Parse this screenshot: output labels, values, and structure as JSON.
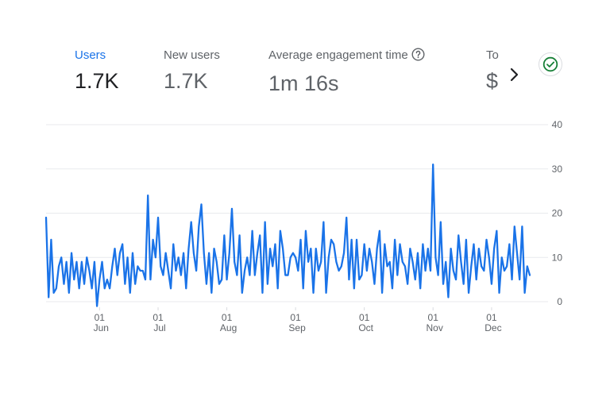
{
  "metrics": [
    {
      "label": "Users",
      "value": "1.7K"
    },
    {
      "label": "New users",
      "value": "1.7K"
    },
    {
      "label": "Average engagement time",
      "value": "1m 16s"
    },
    {
      "label": "To",
      "value": "$"
    }
  ],
  "icons": {
    "help": "help-circle-icon",
    "next": "chevron-right-icon",
    "status": "check-circle-icon"
  },
  "colors": {
    "accent": "#1a73e8",
    "line": "#1a73e8",
    "success": "#188038"
  },
  "chart_data": {
    "type": "line",
    "title": "",
    "ylim": [
      0,
      40
    ],
    "y_ticks": [
      "0",
      "10",
      "20",
      "30",
      "40"
    ],
    "x_ticks": [
      {
        "day": "01",
        "month": "Jun",
        "index": 21
      },
      {
        "day": "01",
        "month": "Jul",
        "index": 44
      },
      {
        "day": "01",
        "month": "Aug",
        "index": 71
      },
      {
        "day": "01",
        "month": "Sep",
        "index": 98
      },
      {
        "day": "01",
        "month": "Oct",
        "index": 125
      },
      {
        "day": "01",
        "month": "Nov",
        "index": 152
      },
      {
        "day": "01",
        "month": "Dec",
        "index": 175
      }
    ],
    "series": [
      {
        "values": [
          19,
          1,
          14,
          2,
          3,
          8,
          10,
          4,
          9,
          2,
          11,
          5,
          9,
          3,
          9,
          4,
          10,
          7,
          3,
          9,
          -1,
          5,
          9,
          3,
          5,
          3,
          8,
          12,
          6,
          11,
          13,
          4,
          10,
          2,
          11,
          4,
          8,
          7,
          7,
          5,
          24,
          5,
          14,
          10,
          19,
          8,
          6,
          11,
          7,
          3,
          13,
          7,
          10,
          6,
          11,
          3,
          12,
          18,
          11,
          7,
          17,
          22,
          11,
          4,
          11,
          2,
          12,
          9,
          4,
          5,
          15,
          5,
          11,
          21,
          9,
          6,
          15,
          2,
          7,
          10,
          6,
          16,
          6,
          11,
          15,
          2,
          18,
          4,
          12,
          8,
          13,
          3,
          16,
          12,
          6,
          6,
          10,
          11,
          10,
          7,
          14,
          3,
          16,
          9,
          12,
          2,
          12,
          7,
          9,
          18,
          2,
          10,
          14,
          13,
          9,
          7,
          8,
          11,
          19,
          5,
          14,
          3,
          14,
          5,
          6,
          13,
          7,
          12,
          9,
          4,
          12,
          16,
          2,
          13,
          8,
          9,
          3,
          14,
          6,
          13,
          9,
          8,
          4,
          12,
          9,
          5,
          11,
          3,
          13,
          7,
          12,
          7,
          31,
          10,
          6,
          18,
          4,
          9,
          1,
          12,
          7,
          5,
          15,
          9,
          4,
          14,
          2,
          8,
          13,
          5,
          12,
          8,
          7,
          14,
          10,
          4,
          12,
          16,
          2,
          10,
          7,
          8,
          13,
          5,
          17,
          11,
          5,
          17,
          2,
          8,
          6
        ],
        "color": "#1a73e8"
      }
    ]
  }
}
